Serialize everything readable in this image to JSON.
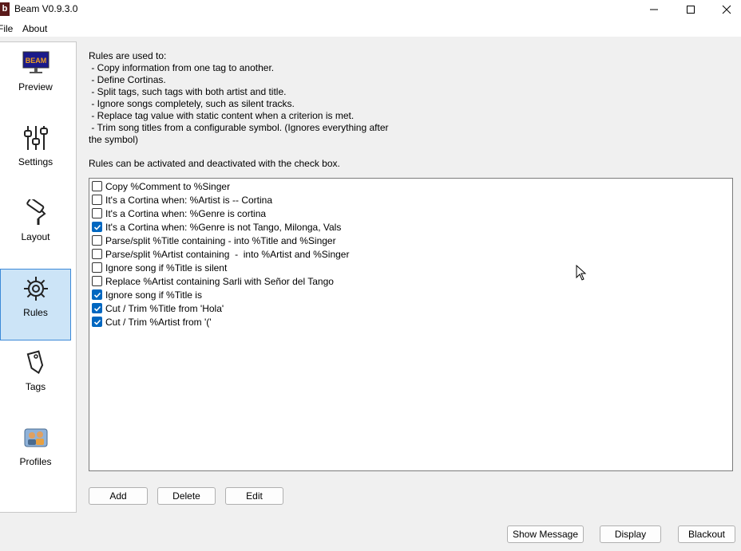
{
  "window": {
    "title": "Beam V0.9.3.0",
    "app_icon_letter": "b"
  },
  "menu": {
    "file": "File",
    "about": "About"
  },
  "sidebar": {
    "items": [
      {
        "label": "Preview",
        "icon": "monitor-icon",
        "active": false
      },
      {
        "label": "Settings",
        "icon": "sliders-icon",
        "active": false
      },
      {
        "label": "Layout",
        "icon": "paint-roller-icon",
        "active": false
      },
      {
        "label": "Rules",
        "icon": "gear-icon",
        "active": true
      },
      {
        "label": "Tags",
        "icon": "tag-icon",
        "active": false
      },
      {
        "label": "Profiles",
        "icon": "profiles-icon",
        "active": false
      }
    ],
    "preview_logo_text": "BEAM"
  },
  "description": {
    "lines": [
      "Rules are used to:",
      " - Copy information from one tag to another.",
      " - Define Cortinas.",
      " - Split tags, such tags with both artist and title.",
      " - Ignore songs completely, such as silent tracks.",
      " - Replace tag value with static content when a criterion is met.",
      " - Trim song titles from a configurable symbol. (Ignores everything after",
      "the symbol)"
    ],
    "hint": "Rules can be activated and deactivated with the check box."
  },
  "rules": [
    {
      "text": "Copy %Comment to %Singer",
      "checked": false
    },
    {
      "text": "It's a Cortina when: %Artist is -- Cortina",
      "checked": false
    },
    {
      "text": "It's a Cortina when: %Genre is cortina",
      "checked": false
    },
    {
      "text": "It's a Cortina when: %Genre is not Tango, Milonga, Vals",
      "checked": true
    },
    {
      "text": "Parse/split %Title containing - into %Title and %Singer",
      "checked": false
    },
    {
      "text": "Parse/split %Artist containing  -  into %Artist and %Singer",
      "checked": false
    },
    {
      "text": "Ignore song if %Title is silent",
      "checked": false
    },
    {
      "text": "Replace %Artist containing Sarli with Señor del Tango",
      "checked": false
    },
    {
      "text": "Ignore song if %Title is",
      "checked": true
    },
    {
      "text": "Cut / Trim %Title from 'Hola'",
      "checked": true
    },
    {
      "text": "Cut / Trim %Artist from '('",
      "checked": true
    }
  ],
  "buttons": {
    "add": "Add",
    "delete": "Delete",
    "edit": "Edit",
    "show_message": "Show Message",
    "display": "Display",
    "blackout": "Blackout"
  },
  "colors": {
    "accent": "#0067c0",
    "active_nav_bg": "#cce4f7",
    "active_nav_border": "#3c8ad8"
  }
}
